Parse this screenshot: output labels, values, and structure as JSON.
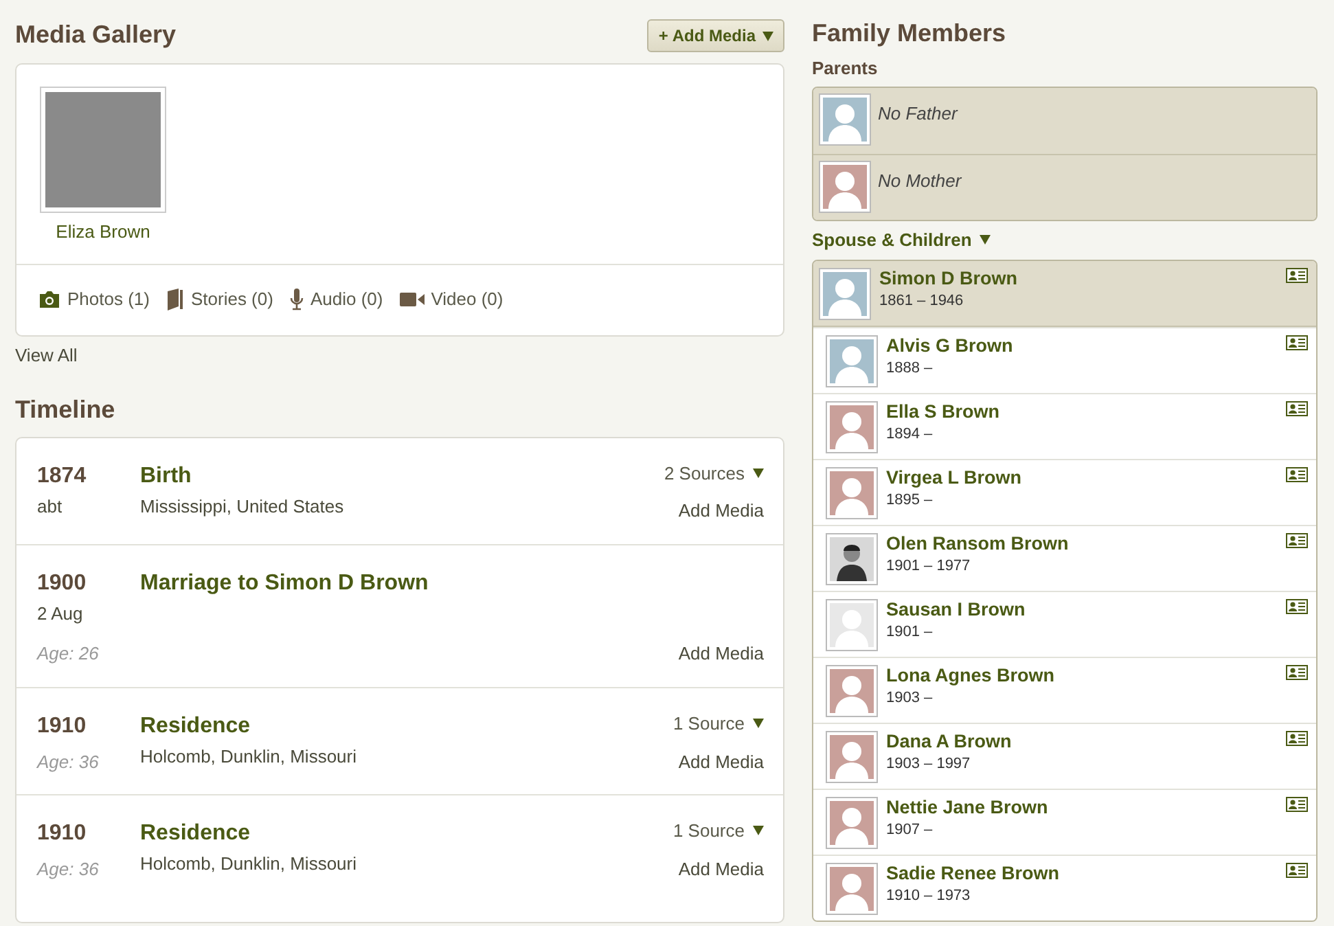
{
  "media_gallery": {
    "title": "Media Gallery",
    "add_button": "+ Add Media",
    "items": [
      {
        "caption": "Eliza Brown"
      }
    ],
    "counts": [
      {
        "kind": "photos",
        "label": "Photos (1)"
      },
      {
        "kind": "stories",
        "label": "Stories (0)"
      },
      {
        "kind": "audio",
        "label": "Audio (0)"
      },
      {
        "kind": "video",
        "label": "Video (0)"
      }
    ],
    "view_all": "View All"
  },
  "timeline": {
    "title": "Timeline",
    "events": [
      {
        "year": "1874",
        "date": "abt",
        "title": "Birth",
        "place": "Mississippi, United States",
        "sources": "2 Sources",
        "add_media": "Add Media"
      },
      {
        "year": "1900",
        "date": "2 Aug",
        "age": "Age: 26",
        "title": "Marriage to Simon D Brown",
        "add_media": "Add Media"
      },
      {
        "year": "1910",
        "age": "Age: 36",
        "title": "Residence",
        "place": "Holcomb, Dunklin, Missouri",
        "sources": "1 Source",
        "add_media": "Add Media"
      },
      {
        "year": "1910",
        "age": "Age: 36",
        "title": "Residence",
        "place": "Holcomb, Dunklin, Missouri",
        "sources": "1 Source",
        "add_media": "Add Media"
      }
    ]
  },
  "family": {
    "title": "Family Members",
    "parents_label": "Parents",
    "parents": [
      {
        "name": "No Father",
        "color": "#a6bfcc"
      },
      {
        "name": "No Mother",
        "color": "#c9a09a"
      }
    ],
    "spouse_label": "Spouse & Children",
    "members": [
      {
        "kind": "spouse",
        "name": "Simon D Brown",
        "years": "1861 – 1946",
        "color": "#a6bfcc"
      },
      {
        "kind": "child",
        "name": "Alvis G Brown",
        "years": "1888 –",
        "color": "#a6bfcc"
      },
      {
        "kind": "child",
        "name": "Ella S Brown",
        "years": "1894 –",
        "color": "#c9a09a"
      },
      {
        "kind": "child",
        "name": "Virgea L Brown",
        "years": "1895 –",
        "color": "#c9a09a"
      },
      {
        "kind": "child",
        "name": "Olen Ransom Brown",
        "years": "1901 – 1977",
        "photo": true
      },
      {
        "kind": "child",
        "name": "Sausan I Brown",
        "years": "1901 –",
        "color": "#e8e8e8"
      },
      {
        "kind": "child",
        "name": "Lona Agnes Brown",
        "years": "1903 –",
        "color": "#c9a09a"
      },
      {
        "kind": "child",
        "name": "Dana A Brown",
        "years": "1903 – 1997",
        "color": "#c9a09a"
      },
      {
        "kind": "child",
        "name": "Nettie Jane Brown",
        "years": "1907 –",
        "color": "#c9a09a"
      },
      {
        "kind": "child",
        "name": "Sadie Renee Brown",
        "years": "1910 – 1973",
        "color": "#c9a09a"
      }
    ]
  }
}
